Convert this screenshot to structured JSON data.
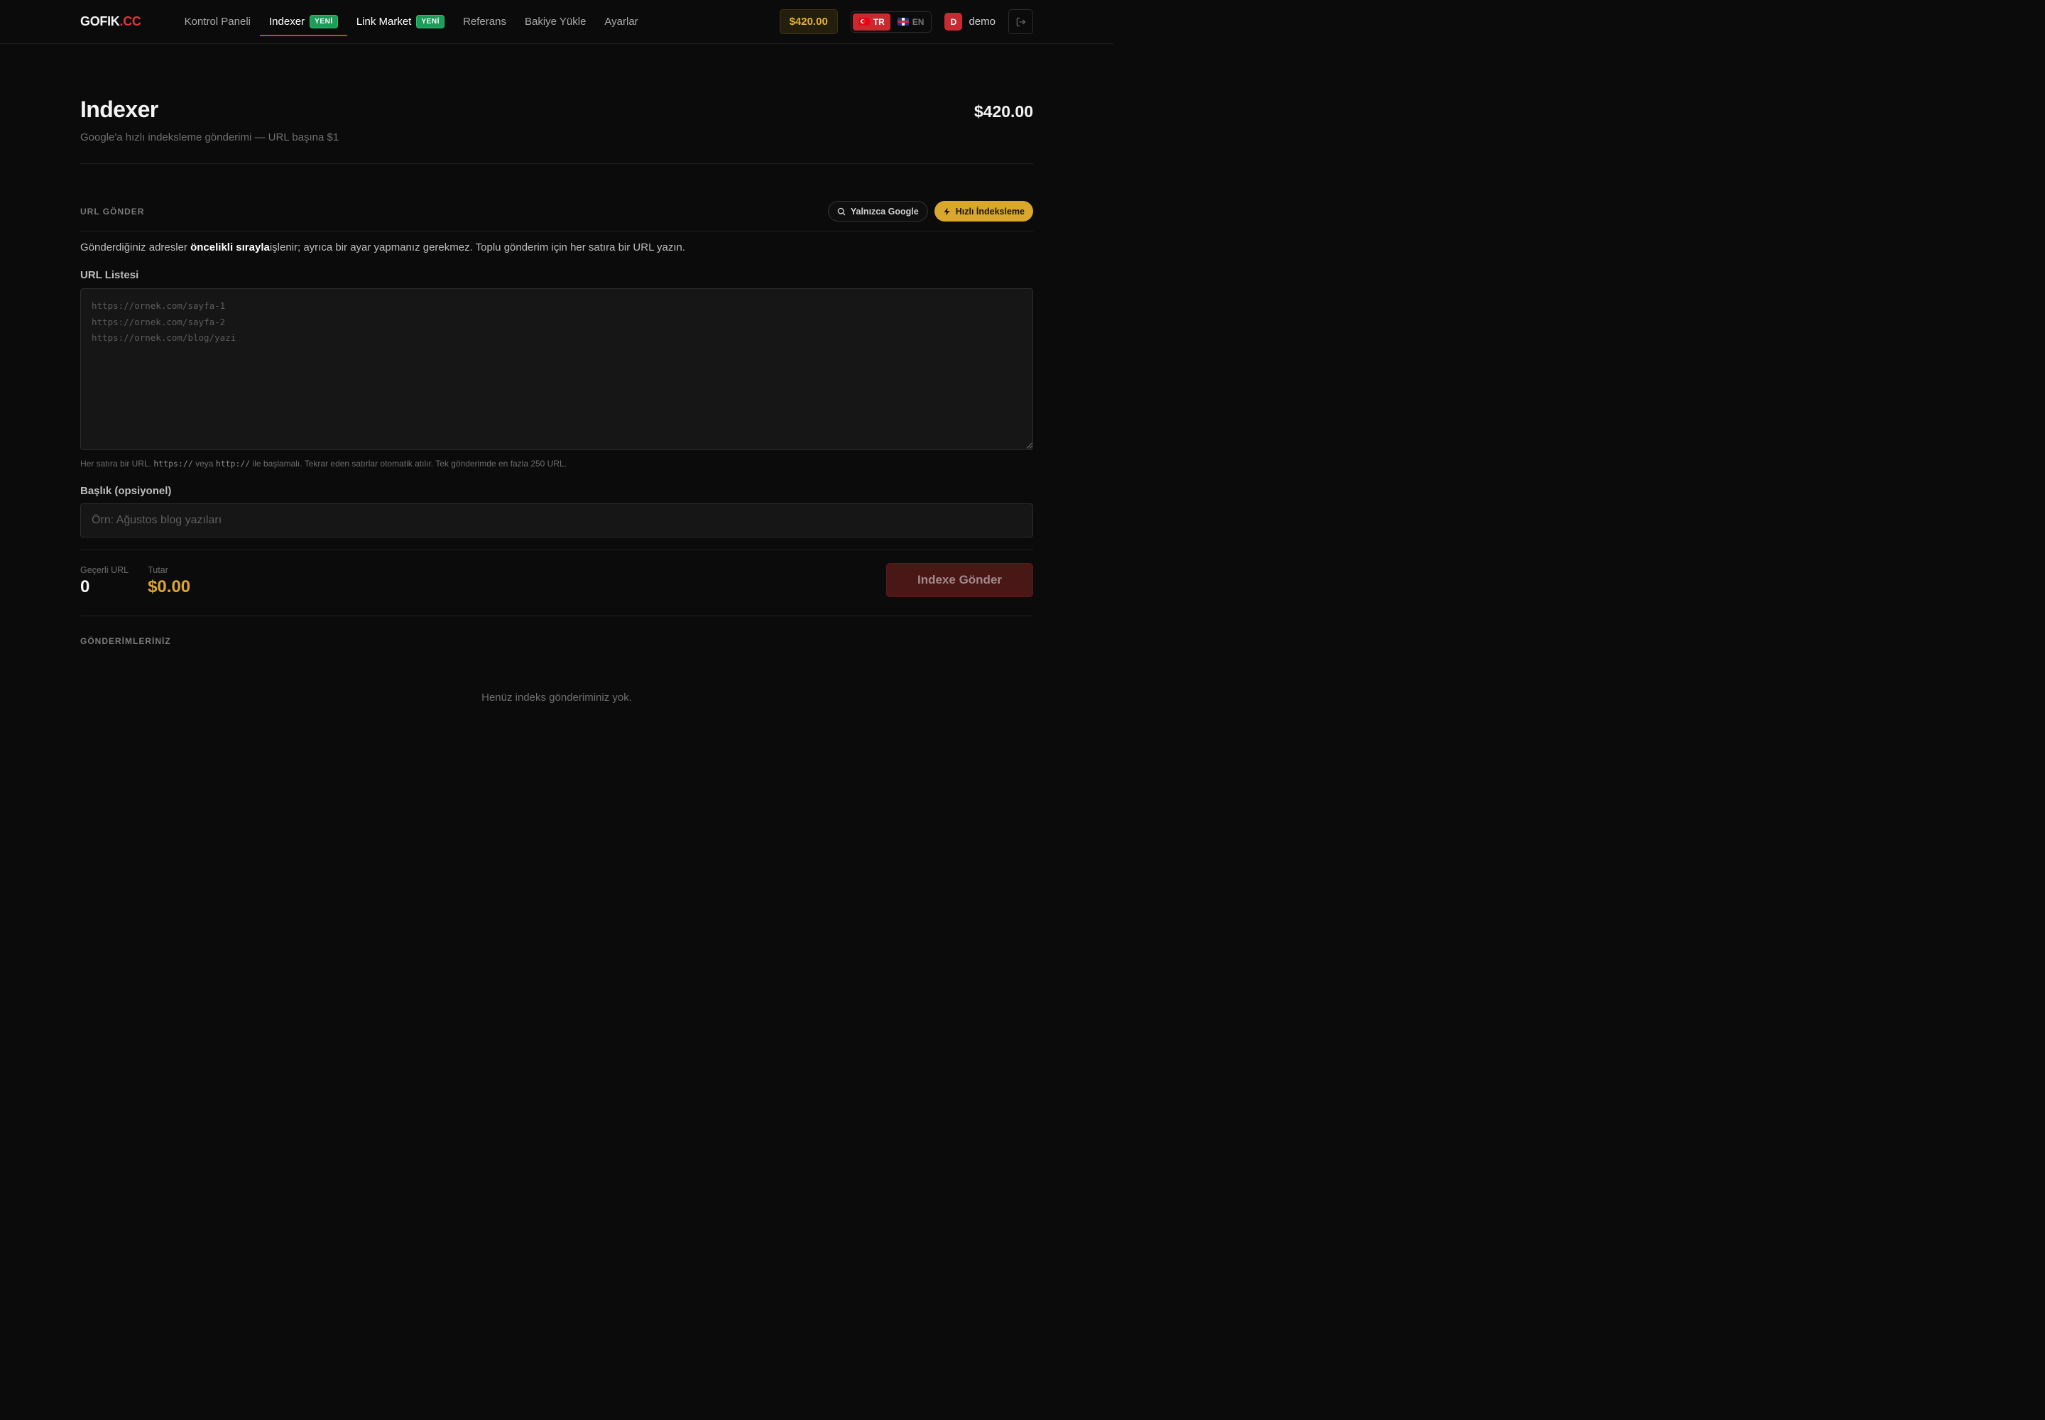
{
  "nav": {
    "logo_main": "GOFIK",
    "logo_suffix": ".CC",
    "items": [
      {
        "label": "Kontrol Paneli"
      },
      {
        "label": "Indexer",
        "badge": "YENİ"
      },
      {
        "label": "Link Market",
        "badge": "YENİ"
      },
      {
        "label": "Referans"
      },
      {
        "label": "Bakiye Yükle"
      },
      {
        "label": "Ayarlar"
      }
    ],
    "active_index": 1,
    "balance": "$420.00",
    "lang": {
      "tr": "TR",
      "en": "EN",
      "active": "TR"
    },
    "user": {
      "initial": "D",
      "name": "demo"
    }
  },
  "header": {
    "title": "Indexer",
    "subtitle": "Google'a hızlı indeksleme gönderimi — URL başına $1",
    "balance": "$420.00"
  },
  "submit_section": {
    "label": "URL GÖNDER",
    "chip_google": "Yalnızca Google",
    "chip_fast": "Hızlı İndeksleme",
    "desc_before": "Gönderdiğiniz adresler ",
    "desc_bold": "öncelikli sırayla",
    "desc_after": "işlenir; ayrıca bir ayar yapmanız gerekmez. Toplu gönderim için her satıra bir URL yazın.",
    "url_list_label": "URL Listesi",
    "url_list_placeholder": "https://ornek.com/sayfa-1\nhttps://ornek.com/sayfa-2\nhttps://ornek.com/blog/yazi",
    "hint_1": "Her satıra bir URL. ",
    "hint_code_1": "https://",
    "hint_2": " veya ",
    "hint_code_2": "http://",
    "hint_3": " ile başlamalı. Tekrar eden satırlar otomatik atılır. Tek gönderimde en fazla 250 URL.",
    "title_label": "Başlık (opsiyonel)",
    "title_placeholder": "Örn: Ağustos blog yazıları",
    "valid_url_label": "Geçerli URL",
    "valid_url_value": "0",
    "amount_label": "Tutar",
    "amount_value": "$0.00",
    "submit_label": "Indexe Gönder"
  },
  "submissions": {
    "label": "GÖNDERİMLERİNİZ",
    "empty": "Henüz indeks gönderiminiz yok."
  },
  "colors": {
    "accent_red": "#e0353b",
    "gold": "#dca631",
    "badge_green": "#1e9c5a"
  }
}
